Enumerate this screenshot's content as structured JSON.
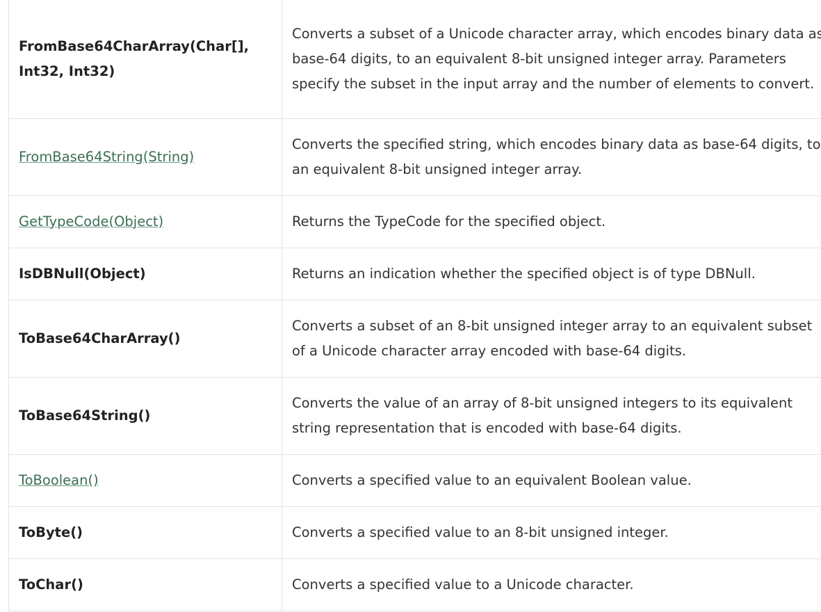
{
  "methods_table": {
    "rows": [
      {
        "method": "FromBase64CharArray(Char[], Int32, Int32)",
        "is_link": false,
        "description": "Converts a subset of a Unicode character array, which encodes binary data as base-64 digits, to an equivalent 8-bit unsigned integer array. Parameters specify the subset in the input array and the number of elements to convert."
      },
      {
        "method": "FromBase64String(String)",
        "is_link": true,
        "description": "Converts the specified string, which encodes binary data as base-64 digits, to an equivalent 8-bit unsigned integer array."
      },
      {
        "method": "GetTypeCode(Object)",
        "is_link": true,
        "description": "Returns the TypeCode for the specified object."
      },
      {
        "method": "IsDBNull(Object)",
        "is_link": false,
        "description": "Returns an indication whether the specified object is of type DBNull."
      },
      {
        "method": "ToBase64CharArray()",
        "is_link": false,
        "description": "Converts a subset of an 8-bit unsigned integer array to an equivalent subset of a Unicode character array encoded with base-64 digits."
      },
      {
        "method": "ToBase64String()",
        "is_link": false,
        "description": "Converts the value of an array of 8-bit unsigned integers to its equivalent string representation that is encoded with base-64 digits."
      },
      {
        "method": "ToBoolean()",
        "is_link": true,
        "description": "Converts a specified value to an equivalent Boolean value."
      },
      {
        "method": "ToByte()",
        "is_link": false,
        "description": "Converts a specified value to an 8-bit unsigned integer."
      },
      {
        "method": "ToChar()",
        "is_link": false,
        "description": "Converts a specified value to a Unicode character."
      }
    ]
  },
  "colors": {
    "link": "#3b6e54",
    "border": "#e3e3e3",
    "text": "#333333"
  }
}
